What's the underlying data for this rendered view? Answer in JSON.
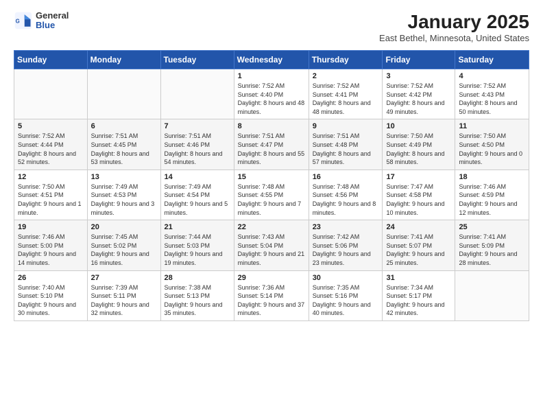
{
  "logo": {
    "general": "General",
    "blue": "Blue"
  },
  "header": {
    "month": "January 2025",
    "location": "East Bethel, Minnesota, United States"
  },
  "weekdays": [
    "Sunday",
    "Monday",
    "Tuesday",
    "Wednesday",
    "Thursday",
    "Friday",
    "Saturday"
  ],
  "weeks": [
    [
      {
        "day": "",
        "detail": ""
      },
      {
        "day": "",
        "detail": ""
      },
      {
        "day": "",
        "detail": ""
      },
      {
        "day": "1",
        "detail": "Sunrise: 7:52 AM\nSunset: 4:40 PM\nDaylight: 8 hours and 48 minutes."
      },
      {
        "day": "2",
        "detail": "Sunrise: 7:52 AM\nSunset: 4:41 PM\nDaylight: 8 hours and 48 minutes."
      },
      {
        "day": "3",
        "detail": "Sunrise: 7:52 AM\nSunset: 4:42 PM\nDaylight: 8 hours and 49 minutes."
      },
      {
        "day": "4",
        "detail": "Sunrise: 7:52 AM\nSunset: 4:43 PM\nDaylight: 8 hours and 50 minutes."
      }
    ],
    [
      {
        "day": "5",
        "detail": "Sunrise: 7:52 AM\nSunset: 4:44 PM\nDaylight: 8 hours and 52 minutes."
      },
      {
        "day": "6",
        "detail": "Sunrise: 7:51 AM\nSunset: 4:45 PM\nDaylight: 8 hours and 53 minutes."
      },
      {
        "day": "7",
        "detail": "Sunrise: 7:51 AM\nSunset: 4:46 PM\nDaylight: 8 hours and 54 minutes."
      },
      {
        "day": "8",
        "detail": "Sunrise: 7:51 AM\nSunset: 4:47 PM\nDaylight: 8 hours and 55 minutes."
      },
      {
        "day": "9",
        "detail": "Sunrise: 7:51 AM\nSunset: 4:48 PM\nDaylight: 8 hours and 57 minutes."
      },
      {
        "day": "10",
        "detail": "Sunrise: 7:50 AM\nSunset: 4:49 PM\nDaylight: 8 hours and 58 minutes."
      },
      {
        "day": "11",
        "detail": "Sunrise: 7:50 AM\nSunset: 4:50 PM\nDaylight: 9 hours and 0 minutes."
      }
    ],
    [
      {
        "day": "12",
        "detail": "Sunrise: 7:50 AM\nSunset: 4:51 PM\nDaylight: 9 hours and 1 minute."
      },
      {
        "day": "13",
        "detail": "Sunrise: 7:49 AM\nSunset: 4:53 PM\nDaylight: 9 hours and 3 minutes."
      },
      {
        "day": "14",
        "detail": "Sunrise: 7:49 AM\nSunset: 4:54 PM\nDaylight: 9 hours and 5 minutes."
      },
      {
        "day": "15",
        "detail": "Sunrise: 7:48 AM\nSunset: 4:55 PM\nDaylight: 9 hours and 7 minutes."
      },
      {
        "day": "16",
        "detail": "Sunrise: 7:48 AM\nSunset: 4:56 PM\nDaylight: 9 hours and 8 minutes."
      },
      {
        "day": "17",
        "detail": "Sunrise: 7:47 AM\nSunset: 4:58 PM\nDaylight: 9 hours and 10 minutes."
      },
      {
        "day": "18",
        "detail": "Sunrise: 7:46 AM\nSunset: 4:59 PM\nDaylight: 9 hours and 12 minutes."
      }
    ],
    [
      {
        "day": "19",
        "detail": "Sunrise: 7:46 AM\nSunset: 5:00 PM\nDaylight: 9 hours and 14 minutes."
      },
      {
        "day": "20",
        "detail": "Sunrise: 7:45 AM\nSunset: 5:02 PM\nDaylight: 9 hours and 16 minutes."
      },
      {
        "day": "21",
        "detail": "Sunrise: 7:44 AM\nSunset: 5:03 PM\nDaylight: 9 hours and 19 minutes."
      },
      {
        "day": "22",
        "detail": "Sunrise: 7:43 AM\nSunset: 5:04 PM\nDaylight: 9 hours and 21 minutes."
      },
      {
        "day": "23",
        "detail": "Sunrise: 7:42 AM\nSunset: 5:06 PM\nDaylight: 9 hours and 23 minutes."
      },
      {
        "day": "24",
        "detail": "Sunrise: 7:41 AM\nSunset: 5:07 PM\nDaylight: 9 hours and 25 minutes."
      },
      {
        "day": "25",
        "detail": "Sunrise: 7:41 AM\nSunset: 5:09 PM\nDaylight: 9 hours and 28 minutes."
      }
    ],
    [
      {
        "day": "26",
        "detail": "Sunrise: 7:40 AM\nSunset: 5:10 PM\nDaylight: 9 hours and 30 minutes."
      },
      {
        "day": "27",
        "detail": "Sunrise: 7:39 AM\nSunset: 5:11 PM\nDaylight: 9 hours and 32 minutes."
      },
      {
        "day": "28",
        "detail": "Sunrise: 7:38 AM\nSunset: 5:13 PM\nDaylight: 9 hours and 35 minutes."
      },
      {
        "day": "29",
        "detail": "Sunrise: 7:36 AM\nSunset: 5:14 PM\nDaylight: 9 hours and 37 minutes."
      },
      {
        "day": "30",
        "detail": "Sunrise: 7:35 AM\nSunset: 5:16 PM\nDaylight: 9 hours and 40 minutes."
      },
      {
        "day": "31",
        "detail": "Sunrise: 7:34 AM\nSunset: 5:17 PM\nDaylight: 9 hours and 42 minutes."
      },
      {
        "day": "",
        "detail": ""
      }
    ]
  ]
}
